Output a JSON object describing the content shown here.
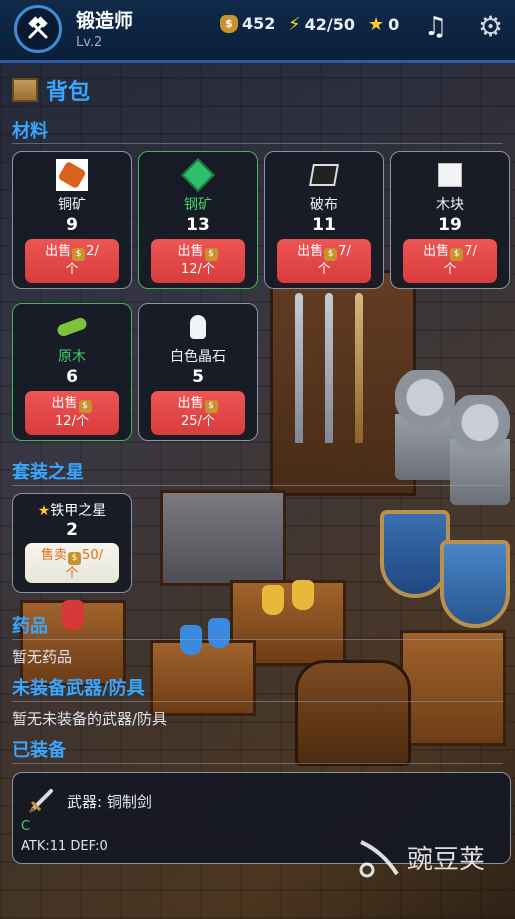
{
  "header": {
    "title": "锻造师",
    "level": "Lv.2",
    "coins": "452",
    "energy": "42/50",
    "stars": "0"
  },
  "bag": {
    "title": "背包"
  },
  "materials": {
    "title": "材料",
    "items": [
      {
        "name": "铜矿",
        "qty": "9",
        "sell_label": "出售",
        "price": "2/",
        "unit": "个",
        "rarity": "common"
      },
      {
        "name": "钢矿",
        "qty": "13",
        "sell_label": "出售",
        "price": "",
        "unit": "12/个",
        "rarity": "uncommon"
      },
      {
        "name": "破布",
        "qty": "11",
        "sell_label": "出售",
        "price": "7/",
        "unit": "个",
        "rarity": "common"
      },
      {
        "name": "木块",
        "qty": "19",
        "sell_label": "出售",
        "price": "7/",
        "unit": "个",
        "rarity": "common"
      },
      {
        "name": "原木",
        "qty": "6",
        "sell_label": "出售",
        "price": "",
        "unit": "12/个",
        "rarity": "uncommon"
      },
      {
        "name": "白色晶石",
        "qty": "5",
        "sell_label": "出售",
        "price": "",
        "unit": "25/个",
        "rarity": "common"
      }
    ]
  },
  "set_stars": {
    "title": "套装之星",
    "items": [
      {
        "name": "铁甲之星",
        "qty": "2",
        "sell_label": "售卖",
        "price": "50/",
        "unit": "个"
      }
    ]
  },
  "potions": {
    "title": "药品",
    "empty": "暂无药品"
  },
  "unequipped": {
    "title": "未装备武器/防具",
    "empty": "暂无未装备的武器/防具"
  },
  "equipped": {
    "title": "已装备",
    "item": {
      "label": "武器: 铜制剑",
      "grade": "C",
      "stats": "ATK:11 DEF:0"
    }
  },
  "watermark": {
    "text": "豌豆荚"
  },
  "colors": {
    "accent": "#38a6ff",
    "sell": "#e04848",
    "uncommon": "#3fd46a"
  }
}
